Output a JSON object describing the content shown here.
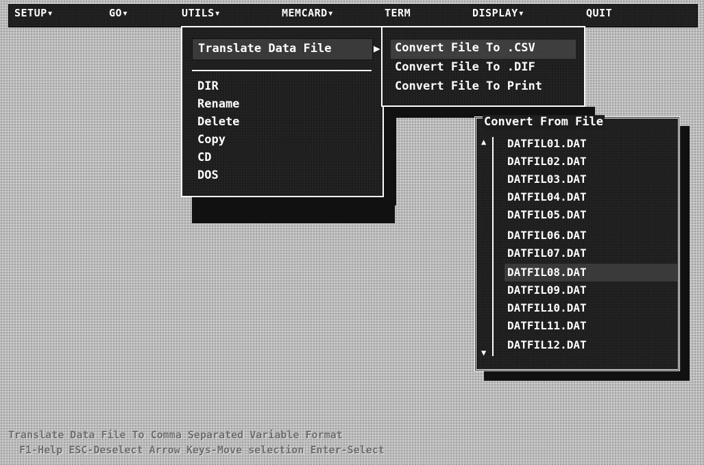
{
  "menubar": {
    "items": [
      "SETUP▾",
      "GO▾",
      "UTILS▾",
      "MEMCARD▾",
      "TERM",
      "DISPLAY▾",
      "QUIT"
    ]
  },
  "utils_menu": {
    "translate_label": "Translate Data File",
    "submenu_arrow": "▶",
    "items": [
      "DIR",
      "Rename",
      "Delete",
      "Copy",
      "CD",
      "DOS"
    ]
  },
  "convert_menu": {
    "items": [
      "Convert File To .CSV",
      "Convert File To .DIF",
      "Convert File To Print"
    ]
  },
  "file_dialog": {
    "title": "Convert From File",
    "scroll_up": "▲",
    "scroll_down": "▼",
    "selected": "DATFIL08.DAT",
    "files": [
      "DATFIL01.DAT",
      "DATFIL02.DAT",
      "DATFIL03.DAT",
      "DATFIL04.DAT",
      "DATFIL05.DAT",
      "DATFIL06.DAT",
      "DATFIL07.DAT",
      "DATFIL08.DAT",
      "DATFIL09.DAT",
      "DATFIL10.DAT",
      "DATFIL11.DAT",
      "DATFIL12.DAT"
    ]
  },
  "status": {
    "line1": "Translate Data File To Comma Separated Variable Format",
    "line2": "F1-Help  ESC-Deselect  Arrow Keys-Move selection  Enter-Select"
  },
  "colors": {
    "background": "#bdbdbd",
    "menu_bg": "#1e1e1e",
    "highlight": "#3a3a3a",
    "text": "#ffffff"
  }
}
